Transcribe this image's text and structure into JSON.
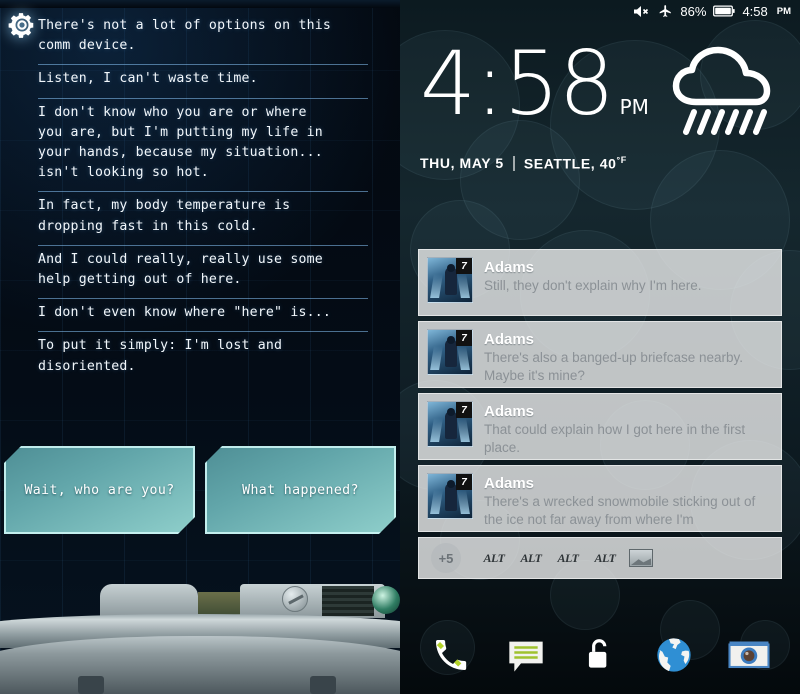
{
  "game": {
    "settings_icon": "gear-icon",
    "dialogue": [
      "There's not a lot of options on this\ncomm device.",
      "Listen, I can't waste time.",
      "I don't know who you are or where\nyou are, but I'm putting my life in\nyour hands, because my situation...\nisn't looking so hot.",
      "In fact, my body temperature is\ndropping fast in this cold.",
      "And I could really, really use some\nhelp getting out of here.",
      "I don't even know where \"here\" is...",
      "To put it simply: I'm lost and\ndisoriented."
    ],
    "choices": [
      {
        "label": "Wait, who are you?"
      },
      {
        "label": "What happened?"
      }
    ]
  },
  "phone": {
    "statusbar": {
      "mute_icon": "volume-mute-icon",
      "airplane_icon": "airplane-mode-icon",
      "battery_percent": "86%",
      "battery_icon": "battery-icon",
      "time": "4:58",
      "ampm": "PM"
    },
    "lockscreen": {
      "clock_time": "4:58",
      "clock_ampm": "PM",
      "date": "THU, MAY 5",
      "location": "SEATTLE,",
      "temperature": "40",
      "temp_unit": "°F",
      "weather_icon": "rain-cloud-icon"
    },
    "notifications": [
      {
        "app_badge": "7",
        "sender": "Adams",
        "message": "Still, they don't explain why I'm here."
      },
      {
        "app_badge": "7",
        "sender": "Adams",
        "message": "There's also a banged-up briefcase nearby. Maybe it's mine?"
      },
      {
        "app_badge": "7",
        "sender": "Adams",
        "message": "That could explain how I got here in the first place."
      },
      {
        "app_badge": "7",
        "sender": "Adams",
        "message": "There's a wrecked snowmobile sticking out of the ice not far away from where I'm"
      }
    ],
    "app_row": {
      "more_count": "+5",
      "apps": [
        "ALT",
        "ALT",
        "ALT",
        "ALT"
      ],
      "gallery_icon": "gallery-icon"
    },
    "dock": [
      {
        "name": "phone-icon",
        "label": "Phone"
      },
      {
        "name": "messages-icon",
        "label": "Messages"
      },
      {
        "name": "unlock-icon",
        "label": "Unlock"
      },
      {
        "name": "browser-icon",
        "label": "Browser"
      },
      {
        "name": "camera-icon",
        "label": "Camera"
      }
    ]
  },
  "colors": {
    "game_accent": "#8fcfcb",
    "phone_bg": "#15272e",
    "card_bg": "#ecedee"
  }
}
